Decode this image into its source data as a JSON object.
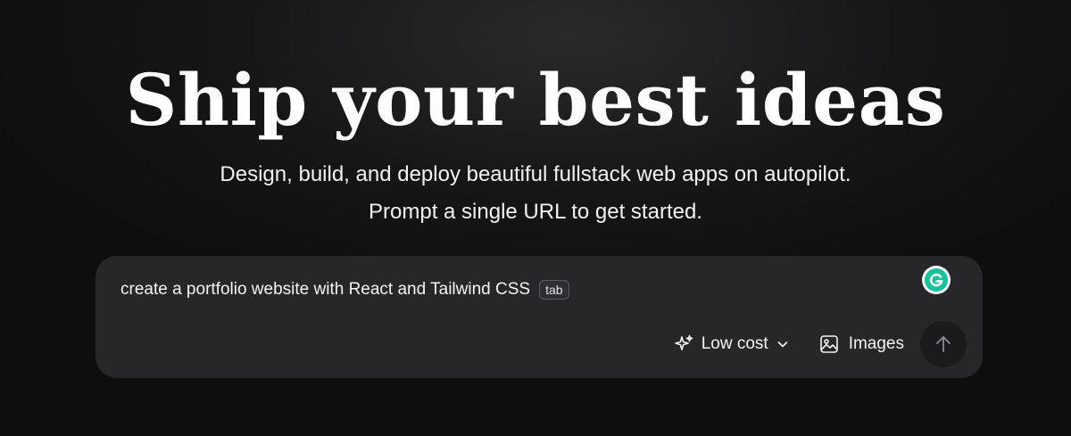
{
  "hero": {
    "title": "Ship your best ideas",
    "subtitle_line1": "Design, build, and deploy beautiful fullstack web apps on autopilot.",
    "subtitle_line2": "Prompt a single URL to get started."
  },
  "prompt": {
    "value": "create a portfolio website with React and Tailwind CSS",
    "tab_hint": "tab",
    "model_label": "Low cost",
    "images_label": "Images"
  },
  "icons": {
    "sparkle": "sparkle-icon",
    "chevron": "chevron-down-icon",
    "image": "image-icon",
    "send": "arrow-up-icon",
    "grammarly": "grammarly-icon"
  },
  "colors": {
    "background": "#0e0e0e",
    "prompt_box": "#27272a",
    "grammarly": "#15c39a"
  }
}
